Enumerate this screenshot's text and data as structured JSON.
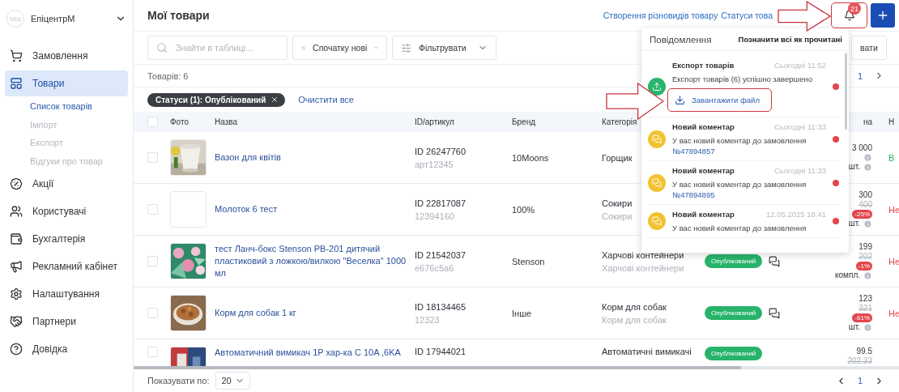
{
  "sidebar": {
    "logo": "МШ",
    "store": "ЕпіцентрМ",
    "items": [
      {
        "label": "Замовлення",
        "selected": false
      },
      {
        "label": "Товари",
        "selected": true,
        "children": [
          {
            "label": "Список товарів",
            "selected": true
          },
          {
            "label": "Імпорт",
            "selected": false
          },
          {
            "label": "Експорт",
            "selected": false
          },
          {
            "label": "Відгуки про товар",
            "selected": false
          }
        ]
      },
      {
        "label": "Акції",
        "selected": false
      },
      {
        "label": "Користувачі",
        "selected": false
      },
      {
        "label": "Бухгалтерія",
        "selected": false
      },
      {
        "label": "Рекламний кабінет",
        "selected": false
      },
      {
        "label": "Налаштування",
        "selected": false
      },
      {
        "label": "Партнери",
        "selected": false
      },
      {
        "label": "Довідка",
        "selected": false
      }
    ]
  },
  "header": {
    "title": "Мої товари",
    "links": [
      "Створення різновидів товару",
      "Статуси това"
    ],
    "notifications_badge": "21",
    "bell_highlighted": true
  },
  "toolbar": {
    "search_placeholder": "Знайти в таблиці...",
    "sort": "Спочатку нові",
    "filter": "Фільтрувати",
    "right_button": "вати"
  },
  "count": "Товарів: 6",
  "top_page": "1",
  "filters": {
    "chip": "Статуси (1): Опублікований",
    "clear": "Очистити все"
  },
  "table": {
    "all_checked": false,
    "columns": [
      "Фото",
      "Назва",
      "ID/артикул",
      "Бренд",
      "Категорія",
      "на",
      "Н"
    ],
    "rows": [
      {
        "checked": false,
        "has_photo": true,
        "name": "Вазон для квітів",
        "id": "ID 26247760",
        "sku": "арт12345",
        "brand": "10Moons",
        "category": "Горщик",
        "price": "3 000",
        "info": true,
        "unit": "шт.",
        "status": "В",
        "color": "#2fa85c"
      },
      {
        "checked": false,
        "has_photo": false,
        "name": "Молоток 6 тест",
        "id": "ID 22817087",
        "sku": "12394160",
        "brand": "100%",
        "category": "Сокири",
        "subcategory": "Сокири",
        "price": "300",
        "old_price": "400",
        "discount": "-25%",
        "unit": "шт.",
        "status": "Не",
        "color": "#e0484f"
      },
      {
        "checked": false,
        "has_photo": true,
        "name": "тест Ланч-бокс Stenson PB-201 дитячий пластиковий з ложкою/вилкою \"Веселка\" 1000 мл",
        "id": "ID 21542037",
        "sku": "e676c5a6",
        "brand": "Stenson",
        "category": "Харчові контейнери",
        "subcategory": "Харчові контейнери",
        "badge": "Опублікований",
        "comments": true,
        "price": "199",
        "old_price": "202",
        "discount": "-1%",
        "unit": "компл.",
        "status": "Не",
        "color": "#e0484f"
      },
      {
        "checked": false,
        "has_photo": true,
        "name": "Корм для собак 1 кг",
        "id": "ID 18134465",
        "sku": "12323",
        "brand": "Інше",
        "category": "Корм для собак",
        "subcategory": "Корм для собак",
        "badge": "Опублікований",
        "comments": true,
        "price": "123",
        "old_price": "321",
        "discount": "-61%",
        "unit": "шт.",
        "status": "Не",
        "color": "#e0484f"
      },
      {
        "checked": false,
        "has_photo": true,
        "name": "Автоматичний вимикач 1P хар-ка C 10A ,6KA",
        "id": "ID 17944021",
        "category": "Автоматичні вимикачі",
        "badge": "Опублікований",
        "price": "99.5",
        "old_price": "202.33"
      }
    ]
  },
  "footer": {
    "per_page_label": "Показувати по:",
    "per_page": "20",
    "page": "1"
  },
  "notifications": {
    "title": "Повідомлення",
    "mark_all": "Позначити всі як прочитані",
    "items": [
      {
        "kind": "export",
        "title": "Експорт товарів",
        "time": "Сьогодні 11:52",
        "text": "Експорт товарів (6) успішно завершено",
        "action": "Завантажити файл",
        "action_highlighted": true,
        "unread": true
      },
      {
        "kind": "comment",
        "title": "Новий коментар",
        "time": "Сьогодні 11:33",
        "text": "У вас новий коментар до замовлення",
        "link": "№47894857",
        "unread": true
      },
      {
        "kind": "comment",
        "title": "Новий коментар",
        "time": "Сьогодні 11:33",
        "text": "У вас новий коментар до замовлення",
        "link": "№47894895",
        "unread": true
      },
      {
        "kind": "comment",
        "title": "Новий коментар",
        "time": "12.05.2025 18:41",
        "text": "У вас новий коментар до замовлення",
        "unread": true
      }
    ]
  }
}
